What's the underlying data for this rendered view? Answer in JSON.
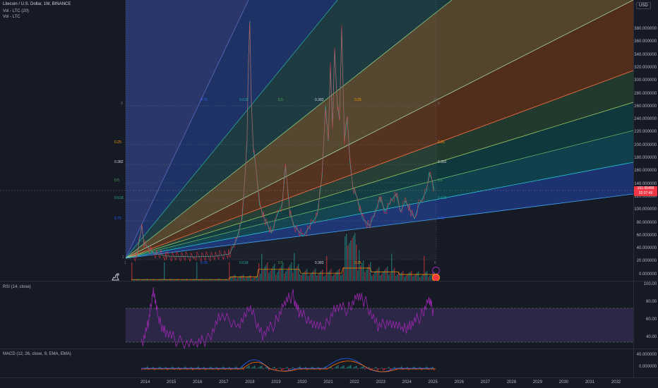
{
  "legend": {
    "title": "Litecoin / U.S. Dollar, 1W, BINANCE",
    "vol1": "Vol - LTC (20)",
    "vol2": "Vol - LTC",
    "rsi": "RSI (14, close)",
    "macd": "MACD (12, 26, close, 9, EMA, EMA)"
  },
  "currency_button": "USD",
  "price_axis": [
    "380.000000",
    "360.000000",
    "340.000000",
    "320.000000",
    "300.000000",
    "280.000000",
    "260.000000",
    "240.000000",
    "220.000000",
    "200.000000",
    "180.000000",
    "160.000000",
    "140.000000",
    "120.000000",
    "100.000000",
    "80.000000",
    "60.000000",
    "40.000000",
    "20.000000",
    "0.000000",
    "-20.000000"
  ],
  "price_tag": {
    "value": "101.95458",
    "sub": "02:37:49"
  },
  "rsi_axis": [
    "100.00",
    "80.00",
    "60.00",
    "40.00"
  ],
  "macd_axis": [
    "40.000000",
    "0.000000"
  ],
  "time_axis": [
    "2014",
    "2015",
    "2016",
    "2017",
    "2018",
    "2019",
    "2020",
    "2021",
    "2022",
    "2023",
    "2024",
    "2025",
    "2026",
    "2027",
    "2028",
    "2029",
    "2030",
    "2031",
    "2032"
  ],
  "fib_levels_left": [
    "0",
    "0.25",
    "0.382",
    "0.5",
    "0.618",
    "0.75",
    "1"
  ],
  "fib_top_labels": [
    "0.75",
    "0.618",
    "0.5",
    "0.382",
    "0.25",
    "0"
  ],
  "fib_right_labels": [
    "0",
    "0.25",
    "0.382",
    "0.5",
    "0.618",
    "0.75"
  ],
  "fib_bottom_labels": [
    "1",
    "0.75",
    "0.618",
    "0.5",
    "0.382",
    "0.25",
    "0"
  ],
  "colors": {
    "up": "#26a69a",
    "down": "#f23645",
    "rsi": "#9c27b0",
    "macd": "#2962ff",
    "signal": "#ff6d00"
  },
  "icons": [
    "dino-icon",
    "settings-icon"
  ]
}
